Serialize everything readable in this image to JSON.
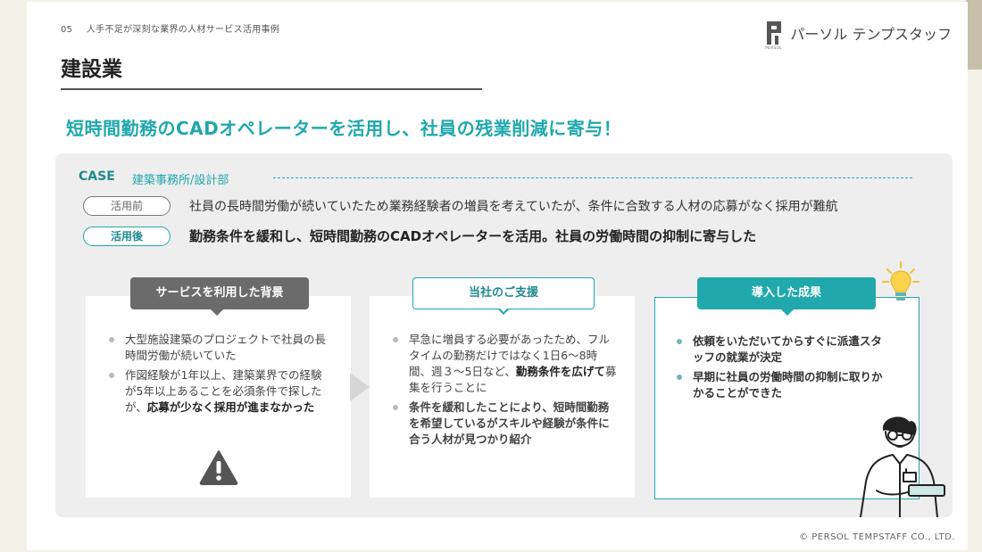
{
  "header": {
    "page_number": "05",
    "section_title": "人手不足が深刻な業界の人材サービス活用事例",
    "brand_name": "パーソル テンプスタッフ",
    "brand_sub": "PERSOL",
    "page_title": "建設業",
    "headline": "短時間勤務のCADオペレーターを活用し、社員の残業削減に寄与！"
  },
  "case": {
    "label": "CASE",
    "department": "建築事務所/設計部",
    "before_label": "活用前",
    "before_text": "社員の長時間労働が続いていたため業務経験者の増員を考えていたが、条件に合致する人材の応募がなく採用が難航",
    "after_label": "活用後",
    "after_text": "勤務条件を緩和し、短時間勤務のCADオペレーターを活用。社員の労働時間の抑制に寄与した"
  },
  "cards": {
    "background": {
      "title": "サービスを利用した背景",
      "item1": "大型施設建築のプロジェクトで社員の長時間労働が続いていた",
      "item2_plain": "作図経験が1年以上、建築業界での経験が5年以上あることを必須条件で探したが、",
      "item2_bold": "応募が少なく採用が進まなかった"
    },
    "support": {
      "title": "当社のご支援",
      "item1_plain": "早急に増員する必要があったため、フルタイムの勤務だけではなく1日6～8時間、週３～5日など、",
      "item1_bold": "勤務条件を広げて",
      "item1_tail": "募集を行うことに",
      "item2": "条件を緩和したことにより、短時間勤務を希望しているがスキルや経験が条件に合う人材が見つかり紹介"
    },
    "result": {
      "title": "導入した成果",
      "item1": "依頼をいただいてからすぐに派遣スタッフの就業が決定",
      "item2": "早期に社員の労働時間の抑制に取りかかることができた"
    }
  },
  "footer": {
    "copyright": "© PERSOL TEMPSTAFF CO., LTD."
  },
  "icons": [
    "persol-logo-icon",
    "warning-icon",
    "lightbulb-icon",
    "arrow-right-icon",
    "person-illustration"
  ],
  "colors": {
    "accent": "#20a8ad",
    "dark_accent": "#1f8a8f",
    "grey_header": "#6b6b6b",
    "panel": "#eeeeee"
  }
}
